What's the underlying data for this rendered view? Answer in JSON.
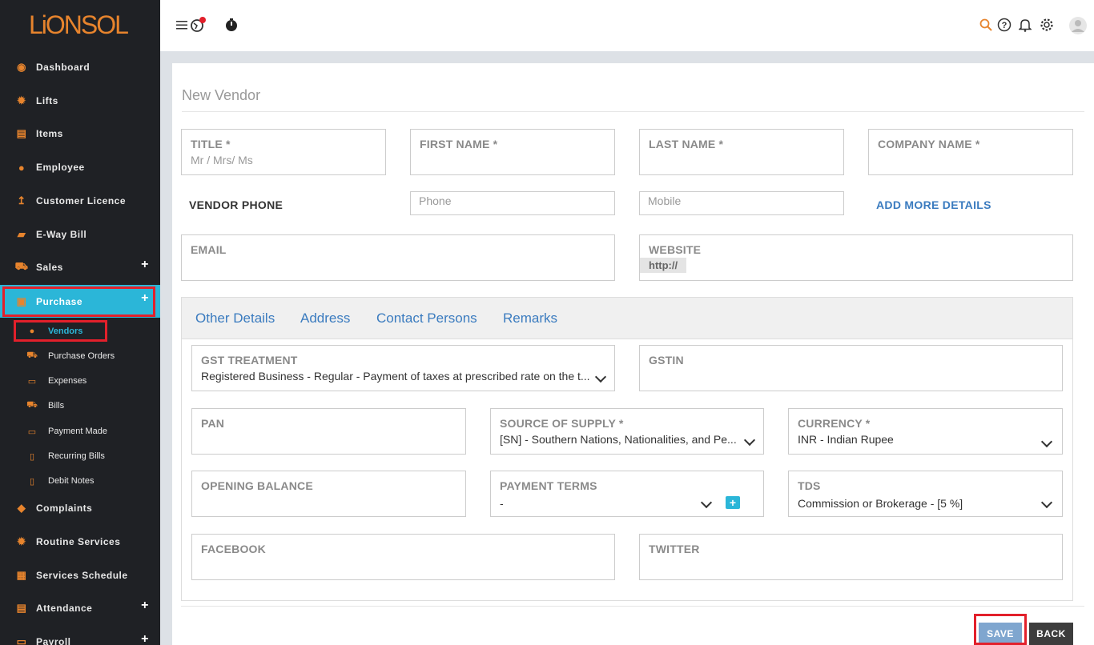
{
  "brand": {
    "logo_text": "LiONSOL"
  },
  "sidebar": {
    "items": [
      {
        "label": "Dashboard"
      },
      {
        "label": "Lifts"
      },
      {
        "label": "Items"
      },
      {
        "label": "Employee"
      },
      {
        "label": "Customer Licence"
      },
      {
        "label": "E-Way Bill"
      },
      {
        "label": "Sales"
      },
      {
        "label": "Purchase"
      },
      {
        "label": "Complaints"
      },
      {
        "label": "Routine Services"
      },
      {
        "label": "Services Schedule"
      },
      {
        "label": "Attendance"
      },
      {
        "label": "Payroll"
      }
    ],
    "purchase_sub": [
      {
        "label": "Vendors"
      },
      {
        "label": "Purchase Orders"
      },
      {
        "label": "Expenses"
      },
      {
        "label": "Bills"
      },
      {
        "label": "Payment Made"
      },
      {
        "label": "Recurring Bills"
      },
      {
        "label": "Debit Notes"
      }
    ],
    "plus": "+"
  },
  "form": {
    "title": "New Vendor",
    "title_field": {
      "label": "TITLE *",
      "placeholder": "Mr / Mrs/ Ms"
    },
    "first_name": {
      "label": "FIRST NAME *"
    },
    "last_name": {
      "label": "LAST NAME *"
    },
    "company_name": {
      "label": "COMPANY NAME *"
    },
    "vendor_phone_label": "VENDOR PHONE",
    "phone_placeholder": "Phone",
    "mobile_placeholder": "Mobile",
    "add_more": "ADD MORE DETAILS",
    "email": {
      "label": "EMAIL"
    },
    "website": {
      "label": "WEBSITE",
      "prefix": "http://"
    },
    "tabs": [
      "Other Details",
      "Address",
      "Contact Persons",
      "Remarks"
    ],
    "gst_treatment": {
      "label": "GST TREATMENT",
      "value": "Registered Business - Regular - Payment of taxes at prescribed rate on the t..."
    },
    "gstin": {
      "label": "GSTIN"
    },
    "pan": {
      "label": "PAN"
    },
    "source_of_supply": {
      "label": "SOURCE OF SUPPLY *",
      "value": "[SN] - Southern Nations, Nationalities, and Pe..."
    },
    "currency": {
      "label": "CURRENCY *",
      "value": "INR - Indian Rupee"
    },
    "opening_balance": {
      "label": "OPENING BALANCE"
    },
    "payment_terms": {
      "label": "PAYMENT TERMS",
      "value": "-"
    },
    "tds": {
      "label": "TDS",
      "value": "Commission or Brokerage - [5 %]"
    },
    "facebook": {
      "label": "FACEBOOK"
    },
    "twitter": {
      "label": "TWITTER"
    },
    "save_label": "SAVE",
    "back_label": "BACK"
  },
  "colors": {
    "accent": "#2bb6d8",
    "orange": "#e7842d",
    "highlight": "#e2202b",
    "sidebar": "#1f2125"
  }
}
